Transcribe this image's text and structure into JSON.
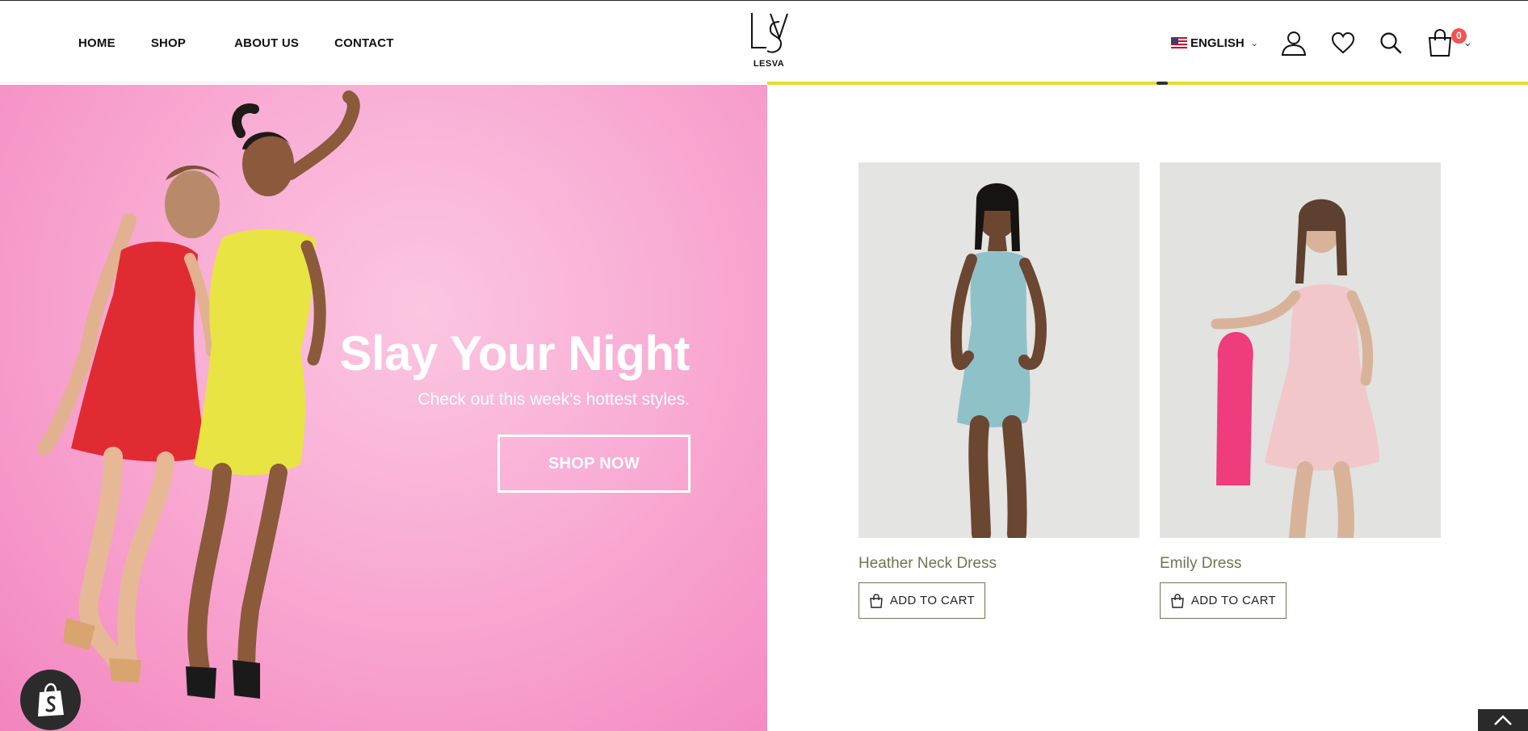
{
  "nav": {
    "items": [
      "HOME",
      "SHOP",
      "ABOUT US",
      "CONTACT"
    ]
  },
  "brand": {
    "logo_text": "LESVA"
  },
  "header": {
    "language": "ENGLISH",
    "cart_count": "0",
    "icons": [
      "user-icon",
      "heart-icon",
      "search-icon",
      "cart-icon",
      "chevron-down-icon"
    ]
  },
  "hero": {
    "title": "Slay Your Night",
    "subtitle": "Check out this week's hottest styles.",
    "button": "SHOP NOW"
  },
  "products": [
    {
      "name": "Heather Neck Dress",
      "button": "ADD TO CART"
    },
    {
      "name": "Emily Dress",
      "button": "ADD TO CART"
    }
  ],
  "colors": {
    "hero_pink": "#f9aed5",
    "accent_yellow": "#e4dc2b",
    "product_name": "#6f7550",
    "cart_badge": "#f25252"
  }
}
